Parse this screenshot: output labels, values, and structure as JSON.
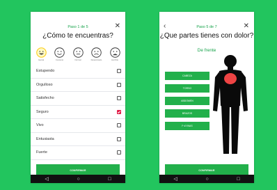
{
  "left_screen": {
    "step": "Paso 1 de 5",
    "question": "¿Cómo te encuentras?",
    "faces": [
      {
        "caption": "Genial",
        "icon": "very-happy-face-icon",
        "selected": true
      },
      {
        "caption": "Contento",
        "icon": "happy-face-icon",
        "selected": false
      },
      {
        "caption": "Normal",
        "icon": "neutral-face-icon",
        "selected": false
      },
      {
        "caption": "Desanimado",
        "icon": "sad-face-icon",
        "selected": false
      },
      {
        "caption": "Horrible",
        "icon": "very-sad-face-icon",
        "selected": false
      }
    ],
    "moods": [
      {
        "label": "Estupendo",
        "checked": false
      },
      {
        "label": "Orgulloso",
        "checked": false
      },
      {
        "label": "Satisfecho",
        "checked": false
      },
      {
        "label": "Seguro",
        "checked": true
      },
      {
        "label": "Vivo",
        "checked": false
      },
      {
        "label": "Entusiasta",
        "checked": false
      },
      {
        "label": "Fuerte",
        "checked": false
      }
    ],
    "confirm_label": "CONFIRMAR"
  },
  "right_screen": {
    "step": "Paso 5 de 7",
    "question": "¿Que partes tienes con dolor?",
    "view_label": "De frente",
    "parts": [
      "CABEZA",
      "TORSO",
      "ABDOMEN",
      "BRAZOS",
      "PIERNAS"
    ],
    "confirm_label": "CONFIRMAR"
  },
  "nav": {
    "back": "◁",
    "home": "○",
    "recents": "□"
  },
  "colors": {
    "background": "#22c55e",
    "accent": "#22b04b",
    "selected_check": "#e11d48",
    "highlight": "#ef4444",
    "face_selected": "#facc15"
  }
}
